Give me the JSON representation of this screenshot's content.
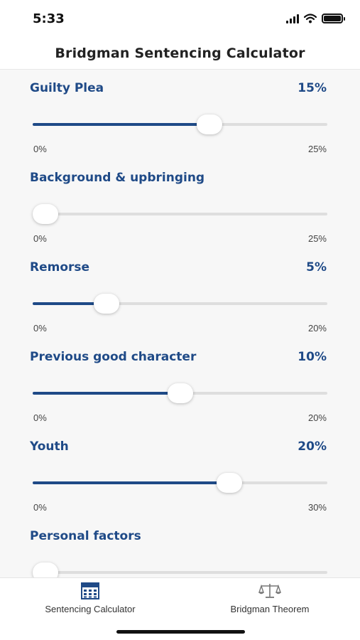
{
  "status_bar": {
    "time": "5:33"
  },
  "header": {
    "title": "Bridgman Sentencing Calculator"
  },
  "factors": [
    {
      "label": "Guilty Plea",
      "value": "15%",
      "min": "0%",
      "max": "25%",
      "level": 0.6
    },
    {
      "label": "Background & upbringing",
      "value": "",
      "min": "0%",
      "max": "25%",
      "level": 0.0
    },
    {
      "label": "Remorse",
      "value": "5%",
      "min": "0%",
      "max": "20%",
      "level": 0.25
    },
    {
      "label": "Previous good character",
      "value": "10%",
      "min": "0%",
      "max": "20%",
      "level": 0.5
    },
    {
      "label": "Youth",
      "value": "20%",
      "min": "0%",
      "max": "30%",
      "level": 0.6667
    },
    {
      "label": "Personal factors",
      "value": "",
      "min": "",
      "max": "",
      "level": 0.0
    }
  ],
  "tabbar": {
    "items": [
      {
        "label": "Sentencing Calculator",
        "icon": "calculator-icon",
        "active": true
      },
      {
        "label": "Bridgman Theorem",
        "icon": "scales-icon",
        "active": false
      }
    ]
  },
  "colors": {
    "accent": "#1f4a87",
    "track": "#dedede",
    "background": "#f7f7f7"
  }
}
